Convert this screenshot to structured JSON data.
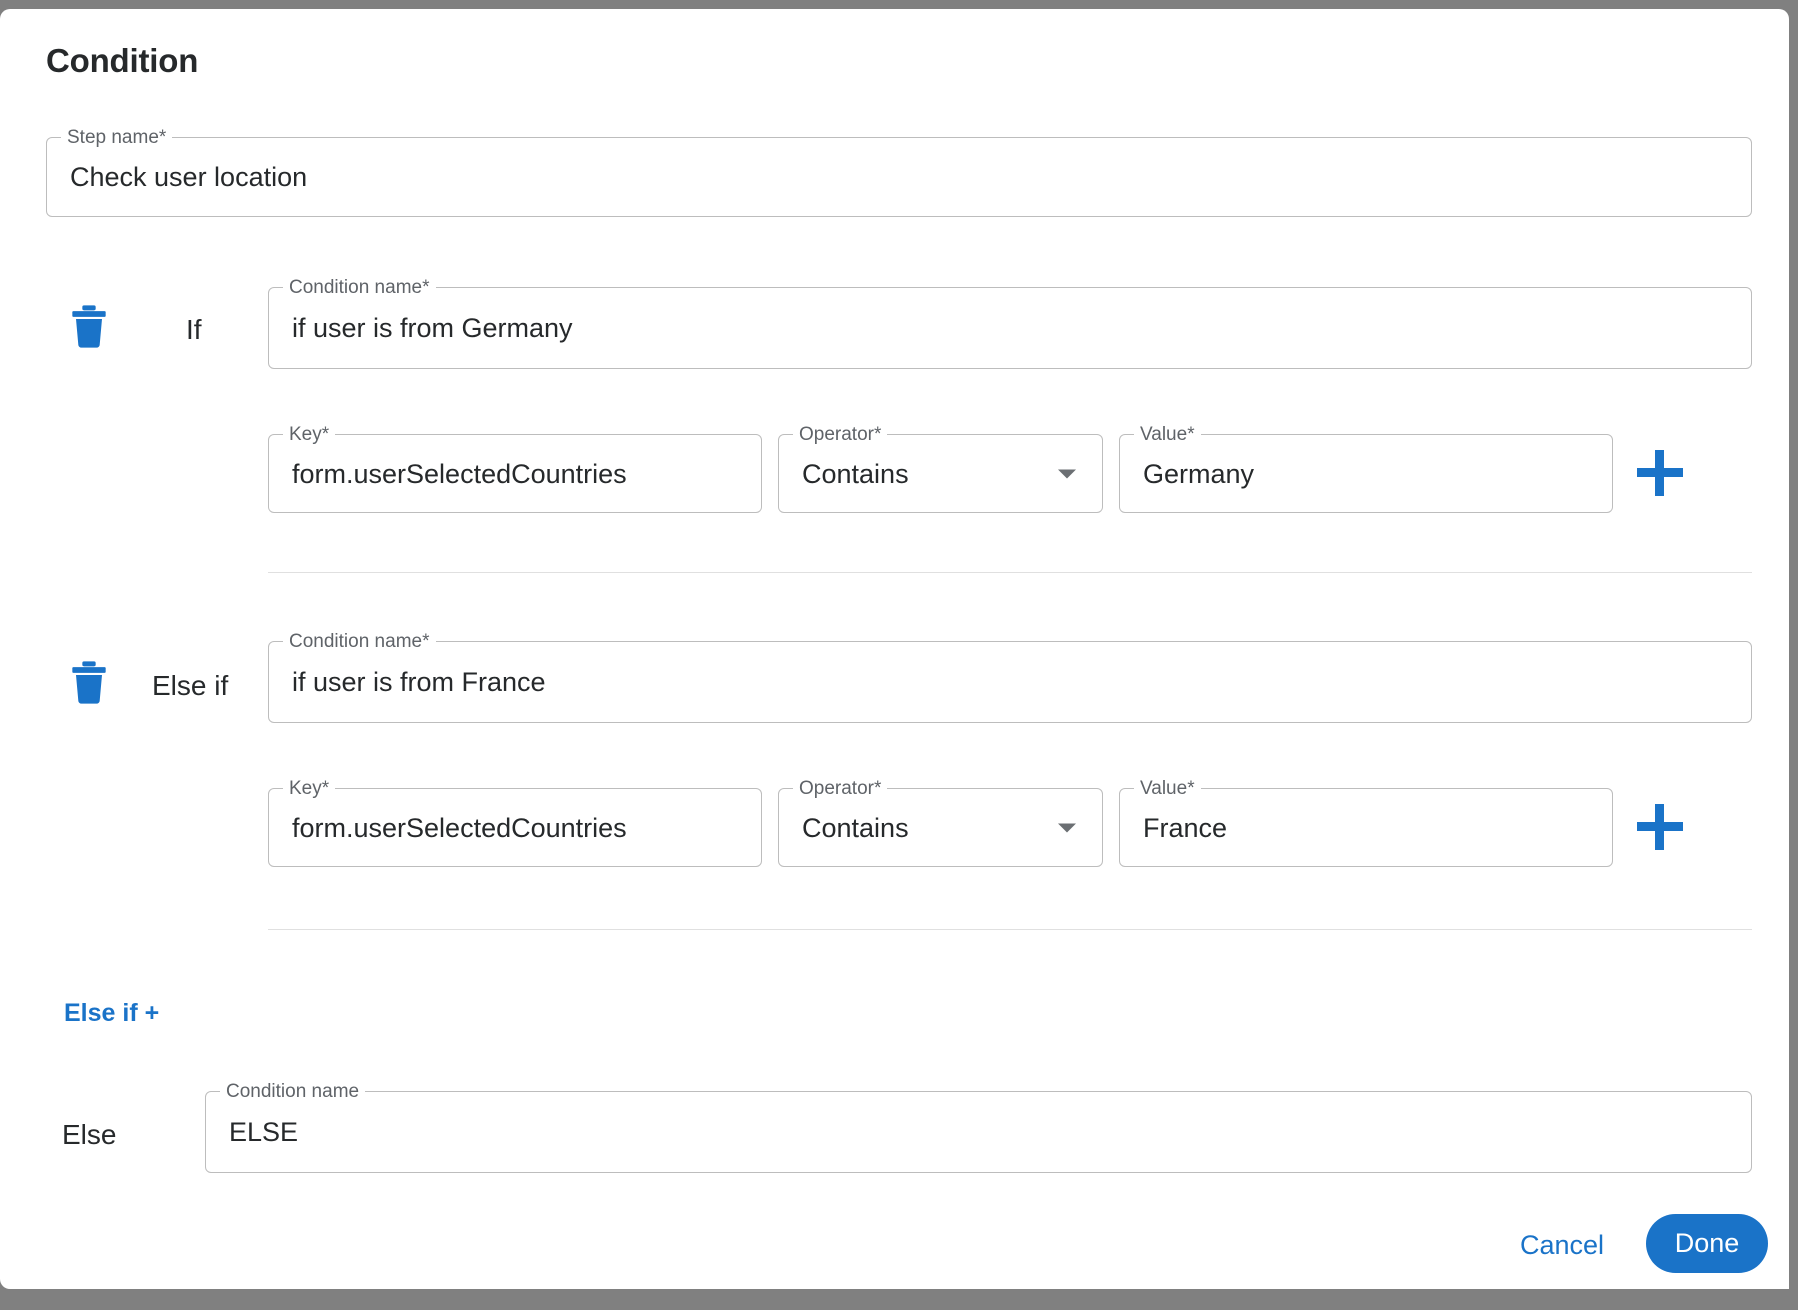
{
  "dialog": {
    "title": "Condition",
    "step_name": {
      "label": "Step name",
      "required_mark": "*",
      "value": "Check user location",
      "placeholder": ""
    },
    "branches": [
      {
        "branch_label": "If",
        "delete_icon": "trash-icon",
        "condition_name": {
          "label": "Condition name",
          "required_mark": "*",
          "value": "if user is from Germany"
        },
        "rule": {
          "key": {
            "label": "Key",
            "required_mark": "*",
            "value": "form.userSelectedCountries"
          },
          "operator": {
            "label": "Operator",
            "required_mark": "*",
            "value": "Contains",
            "caret_icon": "chevron-down-icon"
          },
          "value": {
            "label": "Value",
            "required_mark": "*",
            "value": "Germany"
          },
          "add_icon": "plus-icon"
        }
      },
      {
        "branch_label": "Else if",
        "delete_icon": "trash-icon",
        "condition_name": {
          "label": "Condition name",
          "required_mark": "*",
          "value": "if user is from France"
        },
        "rule": {
          "key": {
            "label": "Key",
            "required_mark": "*",
            "value": "form.userSelectedCountries"
          },
          "operator": {
            "label": "Operator",
            "required_mark": "*",
            "value": "Contains",
            "caret_icon": "chevron-down-icon"
          },
          "value": {
            "label": "Value",
            "required_mark": "*",
            "value": "France"
          },
          "add_icon": "plus-icon"
        }
      }
    ],
    "add_else_if_label": "Else if +",
    "else_branch": {
      "branch_label": "Else",
      "condition_name": {
        "label": "Condition name",
        "required_mark": "",
        "value": "ELSE"
      }
    },
    "footer": {
      "cancel_label": "Cancel",
      "done_label": "Done"
    },
    "colors": {
      "accent": "#1a73c8",
      "text": "#26292b",
      "label": "#5f6368",
      "border": "#bdbdbd",
      "divider": "#e0e0e0",
      "backdrop": "#808080"
    }
  }
}
